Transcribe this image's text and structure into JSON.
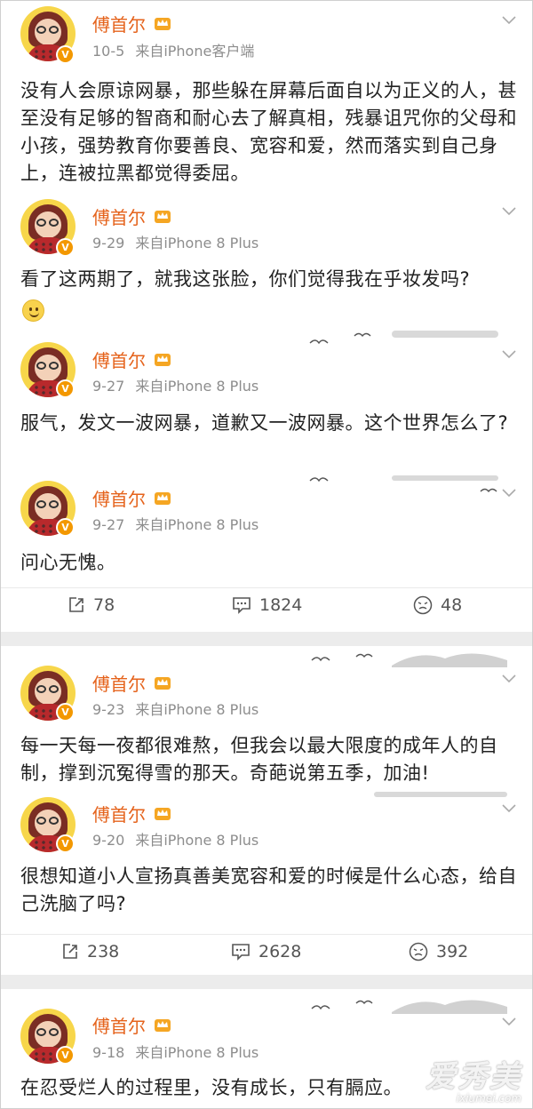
{
  "posts": [
    {
      "author": "傅首尔",
      "date": "10-5",
      "source": "来自iPhone客户端",
      "text": "没有人会原谅网暴，那些躲在屏幕后面自以为正义的人，甚至没有足够的智商和耐心去了解真相，残暴诅咒你的父母和小孩，强势教育你要善良、宽容和爱，然而落实到自己身上，连被拉黑都觉得委屈。"
    },
    {
      "author": "傅首尔",
      "date": "9-29",
      "source": "来自iPhone 8 Plus",
      "text": "看了这两期了，就我这张脸，你们觉得我在乎妆发吗?",
      "emoji": "smile-emoji"
    },
    {
      "author": "傅首尔",
      "date": "9-27",
      "source": "来自iPhone 8 Plus",
      "text": "服气，发文一波网暴，道歉又一波网暴。这个世界怎么了?"
    },
    {
      "author": "傅首尔",
      "date": "9-27",
      "source": "来自iPhone 8 Plus",
      "text": "问心无愧。"
    },
    {
      "author": "傅首尔",
      "date": "9-23",
      "source": "来自iPhone 8 Plus",
      "text": "每一天每一夜都很难熬，但我会以最大限度的成年人的自制，撑到沉冤得雪的那天。奇葩说第五季，加油!"
    },
    {
      "author": "傅首尔",
      "date": "9-20",
      "source": "来自iPhone 8 Plus",
      "text": "很想知道小人宣扬真善美宽容和爱的时候是什么心态，给自己洗脑了吗?"
    },
    {
      "author": "傅首尔",
      "date": "9-18",
      "source": "来自iPhone 8 Plus",
      "text": "在忍受烂人的过程里，没有成长，只有膈应。"
    }
  ],
  "action_bars": [
    {
      "repost": "78",
      "comment": "1824",
      "like": "48"
    },
    {
      "repost": "238",
      "comment": "2628",
      "like": "392"
    }
  ],
  "badge": {
    "letter": "V",
    "color": "#f39800"
  },
  "watermark": {
    "text": "爱秀美",
    "url": "ixiumei.com"
  },
  "colors": {
    "author_name": "#e5631c",
    "meta": "#8d8d8d",
    "divider": "#ececec"
  }
}
